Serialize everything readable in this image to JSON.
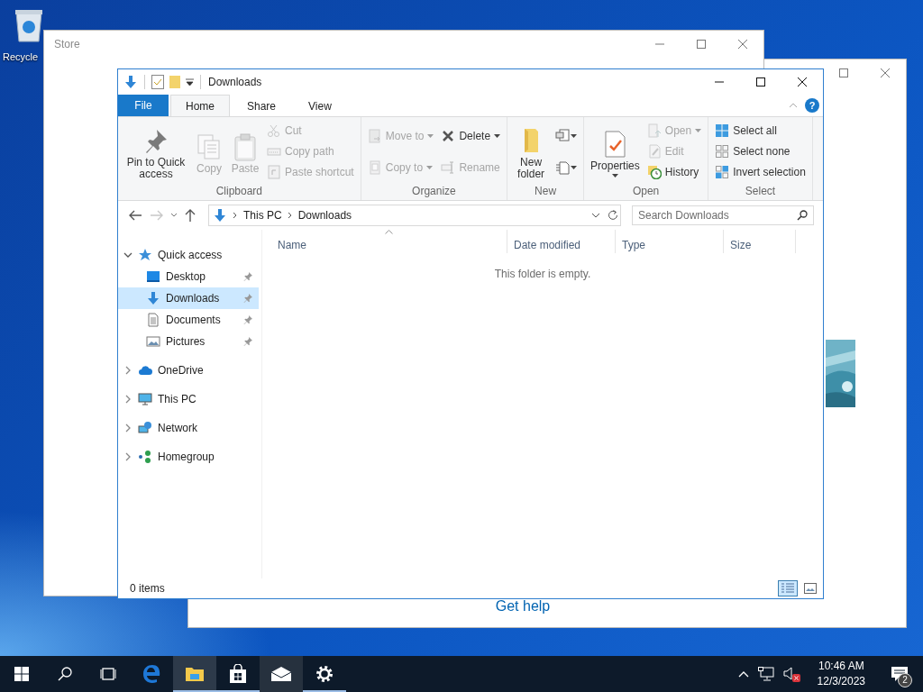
{
  "desktop_icons": [
    {
      "label": "Recycle"
    }
  ],
  "help_window": {
    "link": "Get help"
  },
  "store_window": {
    "title": "Store"
  },
  "explorer": {
    "title": "Downloads",
    "tabs": [
      {
        "label": "File",
        "kind": "file",
        "selected": false
      },
      {
        "label": "Home",
        "kind": "tab",
        "selected": true
      },
      {
        "label": "Share",
        "kind": "tab",
        "selected": false
      },
      {
        "label": "View",
        "kind": "tab",
        "selected": false
      }
    ],
    "help_label": "?",
    "ribbon": [
      {
        "label": "Clipboard",
        "columns": [
          [
            {
              "kind": "large",
              "label": "Pin to Quick access",
              "disabled": false,
              "dropdown": false
            }
          ],
          [
            {
              "kind": "large",
              "label": "Copy",
              "disabled": true,
              "dropdown": false
            }
          ],
          [
            {
              "kind": "large",
              "label": "Paste",
              "disabled": true,
              "dropdown": false
            }
          ],
          [
            {
              "kind": "small",
              "label": "Cut",
              "disabled": true,
              "dropdown": false
            },
            {
              "kind": "small",
              "label": "Copy path",
              "disabled": true,
              "dropdown": false
            },
            {
              "kind": "small",
              "label": "Paste shortcut",
              "disabled": true,
              "dropdown": false
            }
          ]
        ]
      },
      {
        "label": "Organize",
        "columns": [
          [
            {
              "kind": "small",
              "label": "Move to",
              "disabled": true,
              "dropdown": true
            },
            {
              "kind": "small",
              "label": "Copy to",
              "disabled": true,
              "dropdown": true
            }
          ],
          [
            {
              "kind": "small",
              "label": "Delete",
              "disabled": false,
              "dropdown": true
            },
            {
              "kind": "small",
              "label": "Rename",
              "disabled": true,
              "dropdown": false
            }
          ]
        ]
      },
      {
        "label": "New",
        "columns": [
          [
            {
              "kind": "large",
              "label": "New folder",
              "disabled": false,
              "dropdown": false
            }
          ],
          [
            {
              "kind": "icon",
              "disabled": false,
              "dropdown": true
            },
            {
              "kind": "icon",
              "disabled": false,
              "dropdown": true
            }
          ]
        ]
      },
      {
        "label": "Open",
        "columns": [
          [
            {
              "kind": "large",
              "label": "Properties",
              "disabled": false,
              "dropdown": true
            }
          ],
          [
            {
              "kind": "small",
              "label": "Open",
              "disabled": true,
              "dropdown": true
            },
            {
              "kind": "small",
              "label": "Edit",
              "disabled": true,
              "dropdown": false
            },
            {
              "kind": "small",
              "label": "History",
              "disabled": false,
              "dropdown": false
            }
          ]
        ]
      },
      {
        "label": "Select",
        "columns": [
          [
            {
              "kind": "small",
              "label": "Select all",
              "disabled": false,
              "dropdown": false
            },
            {
              "kind": "small",
              "label": "Select none",
              "disabled": false,
              "dropdown": false
            },
            {
              "kind": "small",
              "label": "Invert selection",
              "disabled": false,
              "dropdown": false
            }
          ]
        ]
      }
    ],
    "navigation": {
      "back": {
        "disabled": false
      },
      "forward": {
        "disabled": true
      }
    },
    "address": {
      "path": [
        "This PC",
        "Downloads"
      ]
    },
    "search": {
      "placeholder": "Search Downloads"
    },
    "tree": [
      {
        "label": "Quick access",
        "expanded": true,
        "selected": false,
        "children": [
          {
            "label": "Desktop",
            "selected": false,
            "pinned": true
          },
          {
            "label": "Downloads",
            "selected": true,
            "pinned": true
          },
          {
            "label": "Documents",
            "selected": false,
            "pinned": true
          },
          {
            "label": "Pictures",
            "selected": false,
            "pinned": true
          }
        ]
      },
      {
        "label": "OneDrive",
        "expanded": false,
        "selected": false
      },
      {
        "label": "This PC",
        "expanded": false,
        "selected": false
      },
      {
        "label": "Network",
        "expanded": false,
        "selected": false
      },
      {
        "label": "Homegroup",
        "expanded": false,
        "selected": false
      }
    ],
    "columns": [
      {
        "label": "Name",
        "sorted": true
      },
      {
        "label": "Date modified",
        "sorted": false
      },
      {
        "label": "Type",
        "sorted": false
      },
      {
        "label": "Size",
        "sorted": false
      }
    ],
    "empty_message": "This folder is empty.",
    "status": "0 items",
    "views": [
      {
        "selected": true
      },
      {
        "selected": false
      }
    ]
  },
  "taskbar": {
    "apps": [
      {
        "running": false,
        "active": false,
        "hovered": false
      },
      {
        "running": true,
        "active": true,
        "hovered": false
      },
      {
        "running": true,
        "active": false,
        "hovered": false
      },
      {
        "running": false,
        "active": false,
        "hovered": true
      },
      {
        "running": true,
        "active": false,
        "hovered": false
      }
    ],
    "tray": {
      "time": "10:46 AM",
      "date": "12/3/2023",
      "notification_count": "2"
    }
  }
}
